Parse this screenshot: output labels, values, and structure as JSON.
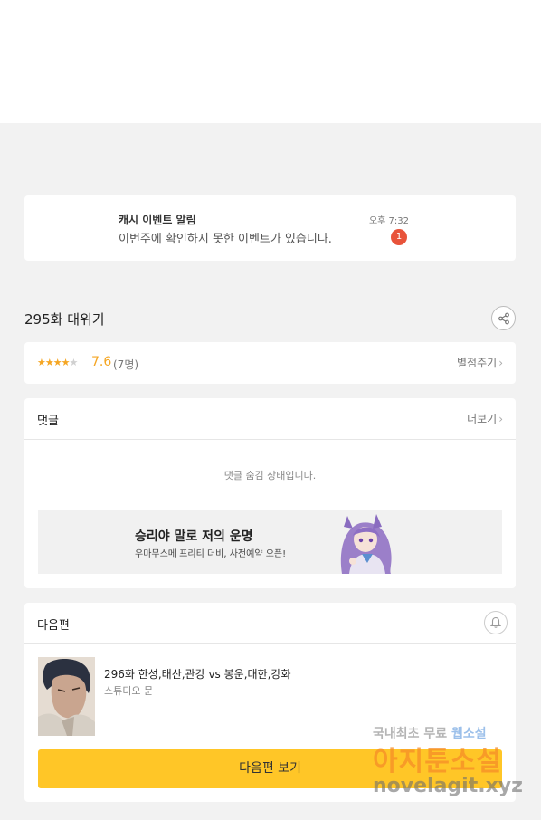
{
  "notification": {
    "title": "캐시 이벤트 알림",
    "message": "이번주에 확인하지 못한 이벤트가 있습니다.",
    "time": "오후 7:32",
    "badge": "1"
  },
  "episode": {
    "title": "295화 대위기",
    "share_icon": "share-icon"
  },
  "rating": {
    "stars_filled": 4,
    "stars_total": 5,
    "score": "7.6",
    "count": "(7명)",
    "rate_label": "별점주기"
  },
  "comments": {
    "title": "댓글",
    "more_label": "더보기",
    "hidden_message": "댓글 숨김 상태입니다.",
    "banner": {
      "title": "승리야 말로 저의 운명",
      "subtitle": "우마무스메 프리티 더비, 사전예약 오픈!"
    }
  },
  "next": {
    "title": "다음편",
    "episode_title": "296화 한성,태산,관강 vs 봉운,대한,강화",
    "studio": "스튜디오 문",
    "button_label": "다음편 보기"
  },
  "watermark": {
    "line1_a": "국내최초 무료",
    "line1_b": "웹소설",
    "line2": "아지툰소설",
    "line3": "novelagit.xyz"
  },
  "colors": {
    "accent": "#ffc627",
    "star": "#f5a623",
    "badge": "#e8533a",
    "background": "#f2f2f2"
  }
}
